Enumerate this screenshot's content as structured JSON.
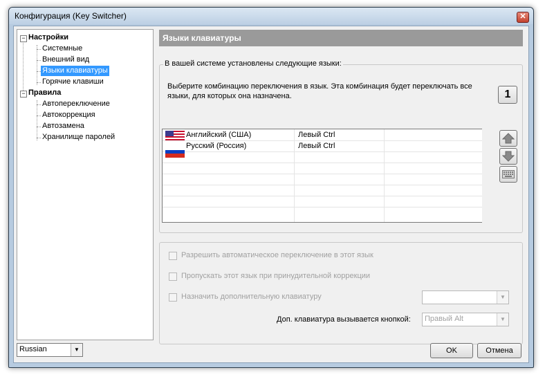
{
  "window": {
    "title": "Конфигурация (Key Switcher)"
  },
  "tree": {
    "groups": [
      {
        "label": "Настройки",
        "items": [
          "Системные",
          "Внешний вид",
          "Языки клавиатуры",
          "Горячие клавиши"
        ]
      },
      {
        "label": "Правила",
        "items": [
          "Автопереключение",
          "Автокоррекция",
          "Автозамена",
          "Хранилище паролей"
        ]
      }
    ],
    "selected": "Языки клавиатуры"
  },
  "ui_language": {
    "selected": "Russian"
  },
  "panel": {
    "title": "Языки клавиатуры"
  },
  "languages_group": {
    "label": "В вашей системе установлены следующие языки:",
    "description": "Выберите комбинацию переключения в язык. Эта комбинация будет переключать все языки, для которых она назначена.",
    "combo_number": "1",
    "rows": [
      {
        "flag": "us-flag-icon",
        "language": "Английский (США)",
        "hotkey": "Левый Ctrl"
      },
      {
        "flag": "ru-flag-icon",
        "language": "Русский (Россия)",
        "hotkey": "Левый Ctrl"
      }
    ],
    "side_buttons": [
      "arrow-up-icon",
      "arrow-down-icon",
      "keyboard-icon"
    ]
  },
  "options_group": {
    "allow_auto_switch": "Разрешить автоматическое переключение в этот язык",
    "skip_forced_correction": "Пропускать этот язык при принудительной коррекции",
    "assign_extra_keyboard": "Назначить дополнительную клавиатуру",
    "extra_keyboard_value": "",
    "hotkey_label": "Доп. клавиатура вызывается кнопкой:",
    "hotkey_value": "Правый Alt"
  },
  "buttons": {
    "ok": "OK",
    "cancel": "Отмена"
  },
  "colors": {
    "selection": "#3399ff",
    "panel_header": "#9a9a9a",
    "title_bar": "#bdd0e4"
  }
}
